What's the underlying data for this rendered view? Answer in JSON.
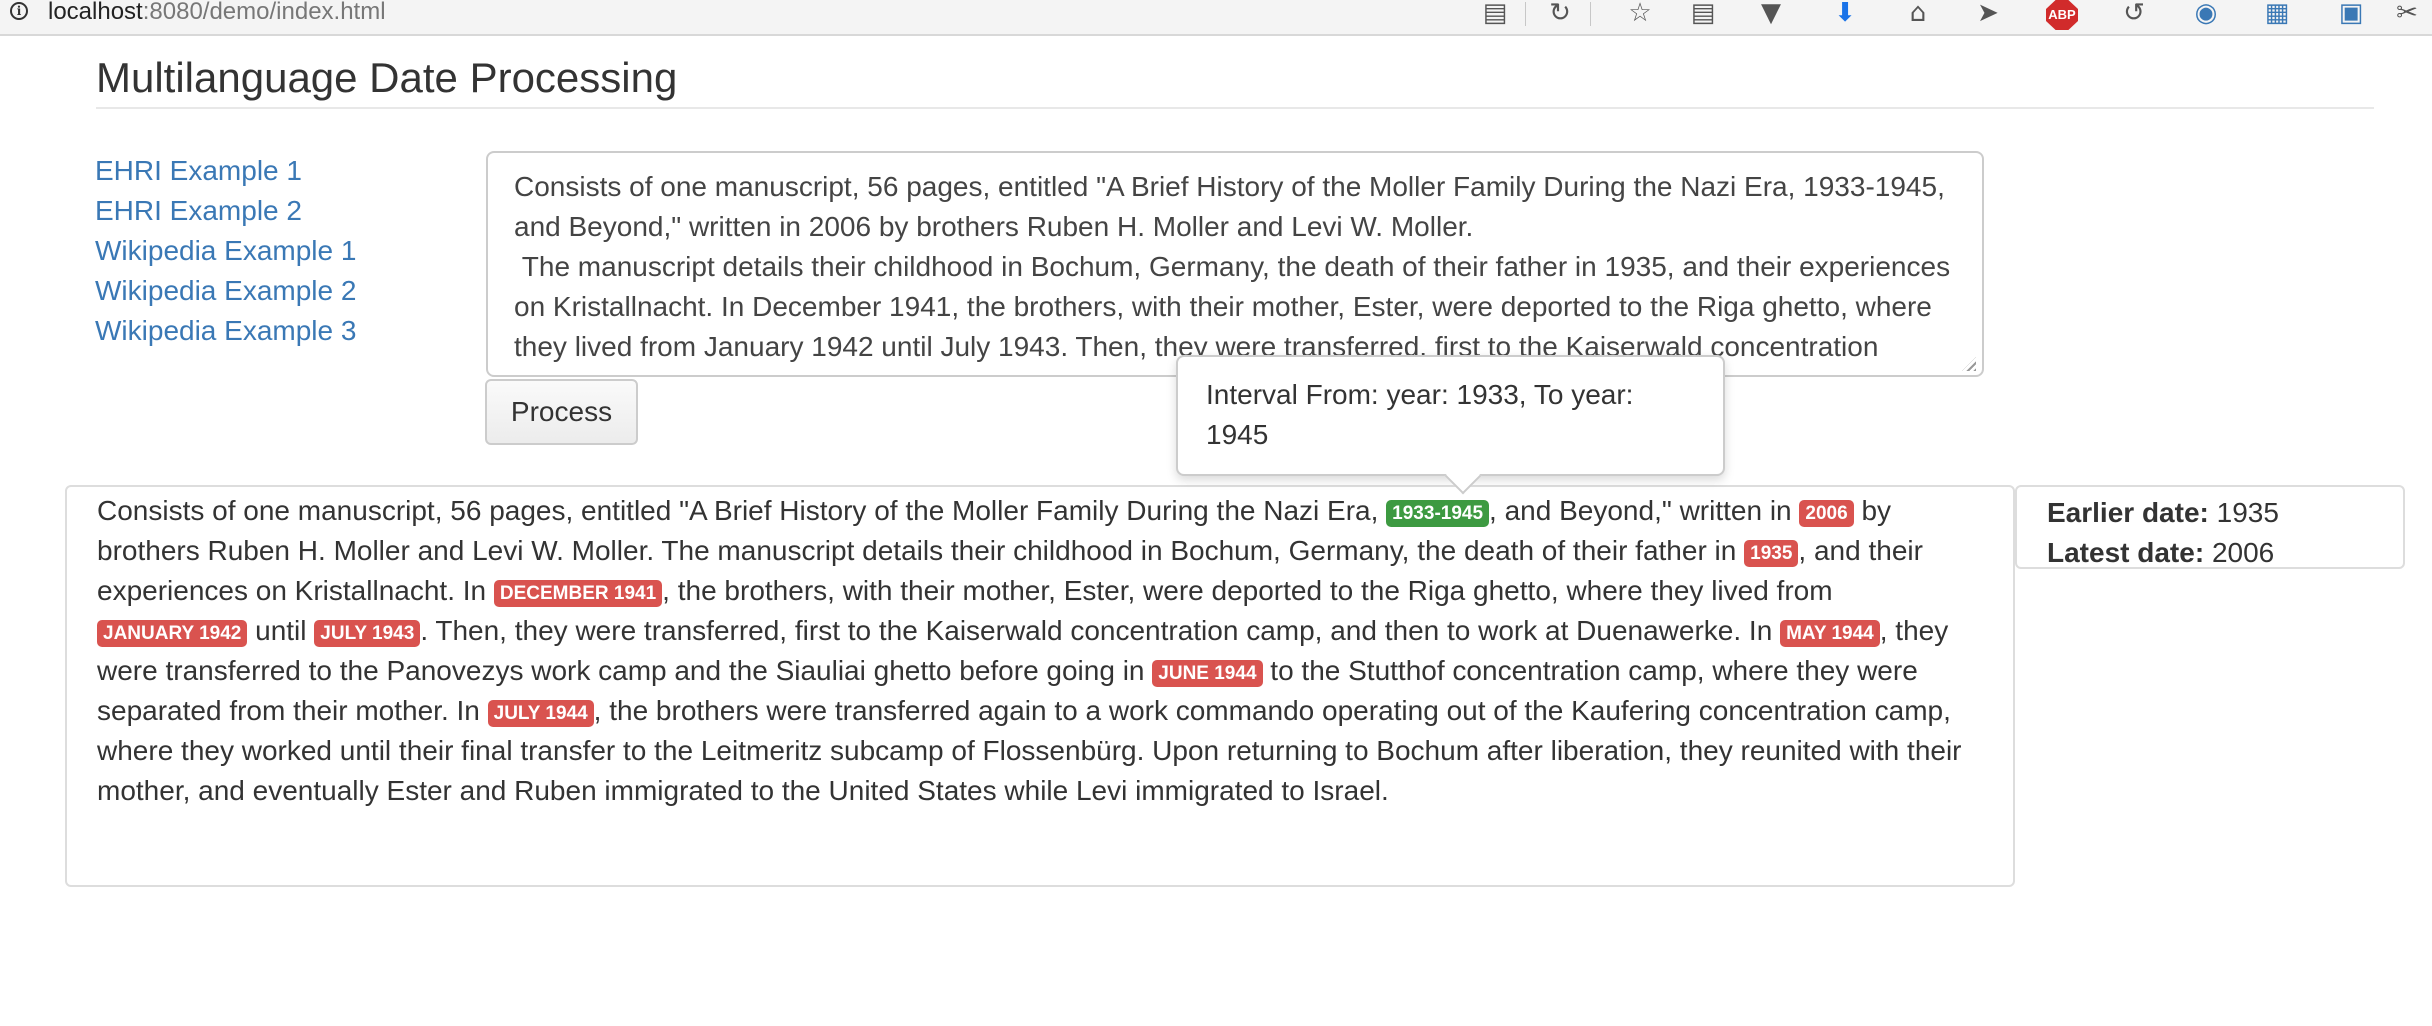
{
  "browser": {
    "url_host": "localhost",
    "url_rest": ":8080/demo/index.html",
    "info_glyph": "i",
    "adblock_label": "ABP",
    "icons": [
      "reader-mode-icon",
      "reload-icon",
      "bookmark-star-icon",
      "library-icon",
      "pocket-icon",
      "download-icon",
      "home-icon",
      "send-icon",
      "adblock-icon",
      "history-icon",
      "extension-icon",
      "image-icon",
      "extension-bookmark-icon",
      "scissors-icon"
    ]
  },
  "page": {
    "title": "Multilanguage Date Processing",
    "examples": [
      "EHRI Example 1",
      "EHRI Example 2",
      "Wikipedia Example 1",
      "Wikipedia Example 2",
      "Wikipedia Example 3"
    ],
    "input_text": "Consists of one manuscript, 56 pages, entitled \"A Brief History of the Moller Family During the Nazi Era, 1933-1945, and Beyond,\" written in 2006 by brothers Ruben H. Moller and Levi W. Moller.\n The manuscript details their childhood in Bochum, Germany, the death of their father in 1935, and their experiences on Kristallnacht. In December 1941, the brothers, with their mother, Ester, were deported to the Riga ghetto, where they lived from January 1942 until July 1943. Then, they were transferred, first to the Kaiserwald concentration camp, and then to work at Duenawerke. In May 1944, they were transferred to the Panovezys work camp and the Siauliai ghetto before going in June 1944 to the Stutthof concentration camp, where they were separated from their mother. In July 1944, the brothers were transferred again to a work commando operating out of the Kaufering concentration camp, where they worked until their final transfer to the Leitmeritz subcamp of Flossenbürg. Upon returning to Bochum after liberation, they reunited with their mother, and eventually Ester and Ruben immigrated to the United States while Levi immigrated to Israel.",
    "process_button": "Process"
  },
  "output": {
    "t0": "Consists of one manuscript, 56 pages, entitled \"A Brief History of the Moller Family During the Nazi Era, ",
    "d0": "1933-1945",
    "t1": ", and Beyond,\" written in ",
    "d1": "2006",
    "t2": " by brothers Ruben H. Moller and Levi W. Moller. The manuscript details their childhood in Bochum, Germany, the death of their father in ",
    "d2": "1935",
    "t3": ", and their experiences on Kristallnacht. In ",
    "d3": "DECEMBER 1941",
    "t4": ", the brothers, with their mother, Ester, were deported to the Riga ghetto, where they lived from ",
    "d4": "JANUARY 1942",
    "t5": " until ",
    "d5": "JULY 1943",
    "t6": ". Then, they were transferred, first to the Kaiserwald concentration camp, and then to work at Duenawerke. In ",
    "d6": "MAY 1944",
    "t7": ", they were transferred to the Panovezys work camp and the Siauliai ghetto before going in ",
    "d7": "JUNE 1944",
    "t8": " to the Stutthof concentration camp, where they were separated from their mother. In ",
    "d8": "JULY 1944",
    "t9": ", the brothers were transferred again to a work commando operating out of the Kaufering concentration camp, where they worked until their final transfer to the Leitmeritz subcamp of Flossenbürg. Upon returning to Bochum after liberation, they reunited with their mother, and eventually Ester and Ruben immigrated to the United States while Levi immigrated to Israel."
  },
  "tooltip": {
    "text": "Interval From: year: 1933, To year: 1945"
  },
  "summary": {
    "earlier_label": "Earlier date:",
    "earlier_value": "1935",
    "latest_label": "Latest date:",
    "latest_value": "2006"
  },
  "colors": {
    "link": "#3a78b5",
    "date_badge": "#d9534f",
    "interval_badge": "#3d9a41"
  }
}
